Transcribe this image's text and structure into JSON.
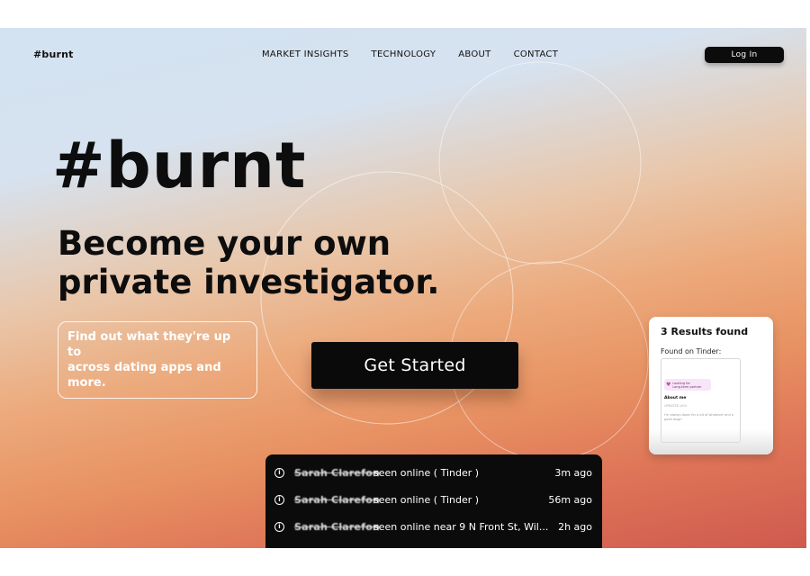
{
  "nav": {
    "brand": "#burnt",
    "links": [
      "MARKET INSIGHTS",
      "TECHNOLOGY",
      "ABOUT",
      "CONTACT"
    ],
    "login_label": "Log In"
  },
  "hero": {
    "brand": "#burnt",
    "tagline_line1": "Become your own",
    "tagline_line2": "private investigator.",
    "subtext_line1": "Find out what they're up to",
    "subtext_line2": "across dating apps and more.",
    "cta_label": "Get Started"
  },
  "results_card": {
    "title": "3 Results found",
    "subtitle": "Found on Tinder:",
    "profile": {
      "looking_for_label": "Looking for",
      "looking_for_value": "Long-term partner",
      "about_heading": "About me",
      "about_sub": "UPDATED AGO",
      "about_text": "I'm always down for a bit of whatever and a good laugh"
    }
  },
  "activity_feed": [
    {
      "name": "Sarah Clarefon",
      "text": "seen online ( Tinder )",
      "time": "3m ago"
    },
    {
      "name": "Sarah Clarefon",
      "text": "seen online ( Tinder )",
      "time": "56m ago"
    },
    {
      "name": "Sarah Clarefon",
      "text": "seen online near 9 N Front St, Wil...",
      "time": "2h ago"
    }
  ],
  "colors": {
    "gradient_top": "#d3e3f2",
    "gradient_mid": "#ecaa7c",
    "gradient_bottom": "#cf5a4f",
    "button": "#0a0a0a"
  }
}
